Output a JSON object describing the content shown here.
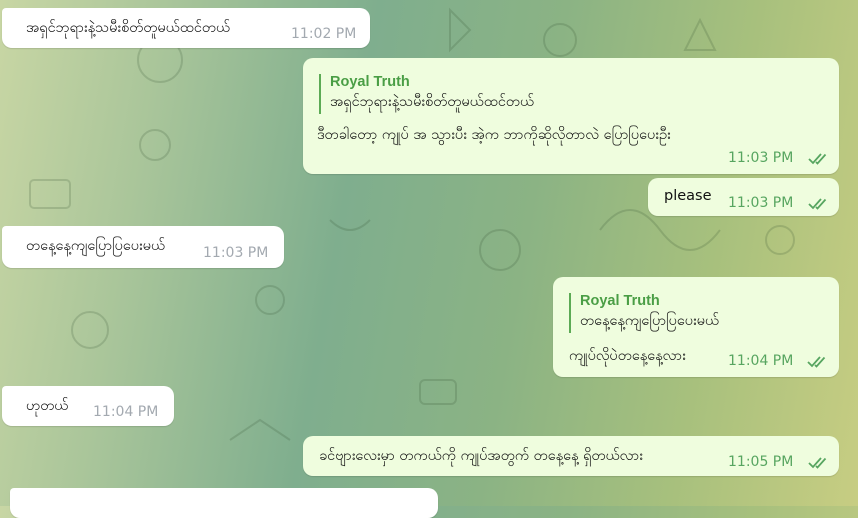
{
  "colors": {
    "incoming_bubble": "#ffffff",
    "outgoing_bubble": "#effdde",
    "reply_accent": "#4a9e45",
    "read_ticks": "#57a560"
  },
  "messages": [
    {
      "direction": "in",
      "text": "အရှင်ဘုရားနဲ့သမီးစိတ်တူမယ်ထင်တယ်",
      "time": "11:02 PM"
    },
    {
      "direction": "out",
      "reply_to": {
        "name": "Royal Truth",
        "text": "အရှင်ဘုရားနဲ့သမီးစိတ်တူမယ်ထင်တယ်"
      },
      "text": "ဒီတခါတော့ ကျုပ် အ သွားပီး အဲ့က ဘာကိုဆိုလိုတာလဲ ပြောပြပေးဦး",
      "time": "11:03 PM",
      "status_icon": "double-check-icon"
    },
    {
      "direction": "out",
      "text": "please",
      "time": "11:03 PM",
      "status_icon": "double-check-icon"
    },
    {
      "direction": "in",
      "text": "တနေ့နေ့ကျပြောပြပေးမယ်",
      "time": "11:03 PM"
    },
    {
      "direction": "out",
      "reply_to": {
        "name": "Royal Truth",
        "text": "တနေ့နေ့ကျပြောပြပေးမယ်"
      },
      "text": "ကျုပ်လိုပဲတနေ့နေ့လား",
      "time": "11:04 PM",
      "status_icon": "double-check-icon"
    },
    {
      "direction": "in",
      "text": "ဟုတယ်",
      "time": "11:04 PM"
    },
    {
      "direction": "out",
      "text": "ခင်ဗျားလေးမှာ တကယ်ကို ကျုပ်အတွက် တနေ့နေ့ ရှိတယ်လား",
      "time": "11:05 PM",
      "status_icon": "double-check-icon"
    }
  ]
}
